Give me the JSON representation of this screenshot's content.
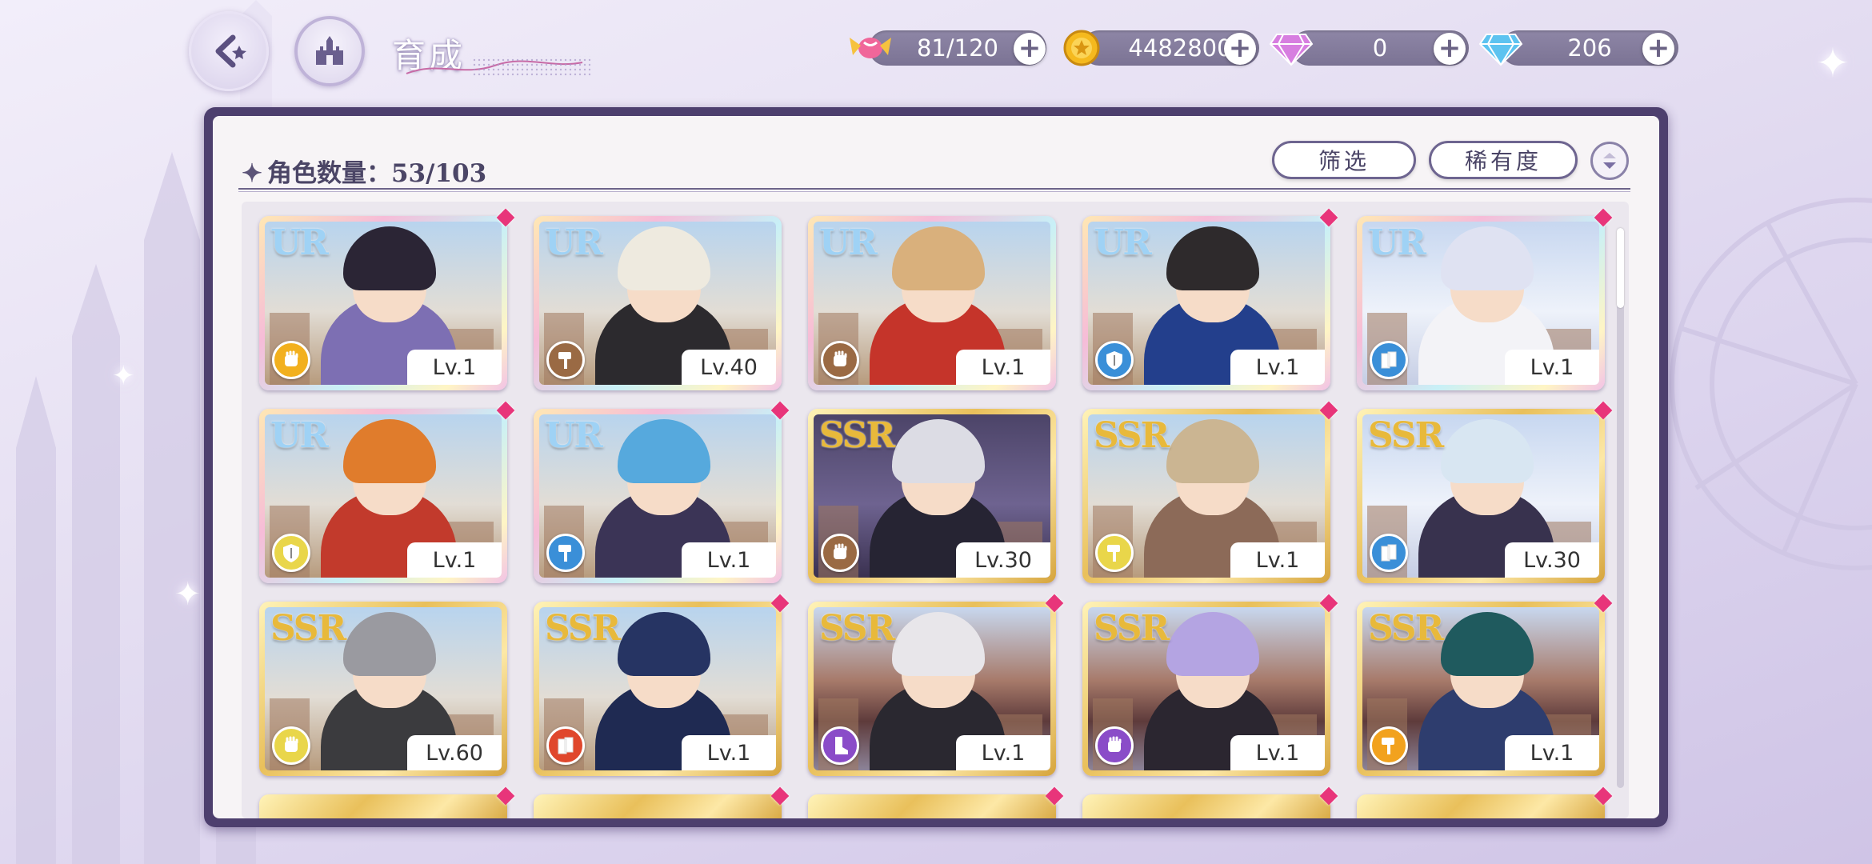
{
  "header": {
    "title": "育成",
    "resources": [
      {
        "name": "stamina",
        "icon": "candy-icon",
        "value": "81/120"
      },
      {
        "name": "gold",
        "icon": "gold-coin-icon",
        "value": "4482800"
      },
      {
        "name": "pink_gem",
        "icon": "pink-diamond-icon",
        "value": "0"
      },
      {
        "name": "blue_gem",
        "icon": "blue-diamond-icon",
        "value": "206"
      }
    ]
  },
  "panel": {
    "count_label": "角色数量：53/103",
    "filter_label": "筛选",
    "sort_label": "稀有度"
  },
  "colors": {
    "panel_border": "#4d3f6e",
    "new_marker": "#e8357a",
    "ur_frame": "#c8f0f7",
    "ssr_frame": "#e9c05b"
  },
  "cards": [
    {
      "rarity": "UR",
      "level": "Lv.1",
      "role": "fist",
      "role_color": "#f2b01e",
      "hair": "#2b2535",
      "outfit": "#7d6fb3",
      "bg": "castle",
      "new": true
    },
    {
      "rarity": "UR",
      "level": "Lv.40",
      "role": "hammer",
      "role_color": "#9a6a44",
      "hair": "#eeeadf",
      "outfit": "#2c2a2e",
      "bg": "castle",
      "new": false
    },
    {
      "rarity": "UR",
      "level": "Lv.1",
      "role": "fist",
      "role_color": "#9a6a44",
      "hair": "#d9b07c",
      "outfit": "#c5342a",
      "bg": "castle",
      "new": false
    },
    {
      "rarity": "UR",
      "level": "Lv.1",
      "role": "shield",
      "role_color": "#3a8fd8",
      "hair": "#2e2a2c",
      "outfit": "#233f8c",
      "bg": "castle",
      "new": true
    },
    {
      "rarity": "UR",
      "level": "Lv.1",
      "role": "book",
      "role_color": "#3a8fd8",
      "hair": "#dfe2f2",
      "outfit": "#f3f3f7",
      "bg": "snow",
      "new": true
    },
    {
      "rarity": "UR",
      "level": "Lv.1",
      "role": "shield",
      "role_color": "#e9d64a",
      "hair": "#e07c2c",
      "outfit": "#c23a2c",
      "bg": "castle",
      "new": true
    },
    {
      "rarity": "UR",
      "level": "Lv.1",
      "role": "hammer",
      "role_color": "#3a8fd8",
      "hair": "#56a9dd",
      "outfit": "#3b3456",
      "bg": "castle",
      "new": true
    },
    {
      "rarity": "SSR",
      "level": "Lv.30",
      "role": "fist",
      "role_color": "#9a6a44",
      "hair": "#dcdce4",
      "outfit": "#262433",
      "bg": "dark",
      "new": false
    },
    {
      "rarity": "SSR",
      "level": "Lv.1",
      "role": "hammer",
      "role_color": "#e9d64a",
      "hair": "#cbb592",
      "outfit": "#8c6a58",
      "bg": "castle",
      "new": true
    },
    {
      "rarity": "SSR",
      "level": "Lv.30",
      "role": "book",
      "role_color": "#3a8fd8",
      "hair": "#d8e6f2",
      "outfit": "#38324e",
      "bg": "snow",
      "new": true
    },
    {
      "rarity": "SSR",
      "level": "Lv.60",
      "role": "fist",
      "role_color": "#e9d64a",
      "hair": "#9a9aa0",
      "outfit": "#3b3b3e",
      "bg": "castle",
      "new": false
    },
    {
      "rarity": "SSR",
      "level": "Lv.1",
      "role": "book",
      "role_color": "#e0472c",
      "hair": "#263463",
      "outfit": "#1f2a52",
      "bg": "castle",
      "new": true
    },
    {
      "rarity": "SSR",
      "level": "Lv.1",
      "role": "boot",
      "role_color": "#8a4cc8",
      "hair": "#e8e6ea",
      "outfit": "#2a2830",
      "bg": "asian",
      "new": true
    },
    {
      "rarity": "SSR",
      "level": "Lv.1",
      "role": "fist",
      "role_color": "#8a4cc8",
      "hair": "#b4a4e2",
      "outfit": "#2b2630",
      "bg": "asian",
      "new": true
    },
    {
      "rarity": "SSR",
      "level": "Lv.1",
      "role": "hammer",
      "role_color": "#f2a21e",
      "hair": "#1f5a5e",
      "outfit": "#2e3d6e",
      "bg": "asian",
      "new": true
    }
  ]
}
